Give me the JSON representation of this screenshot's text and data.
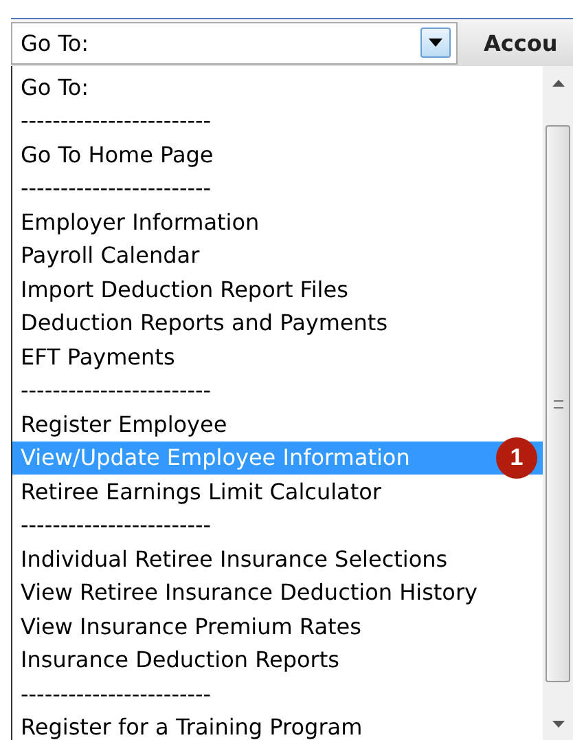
{
  "select": {
    "value": "Go To:"
  },
  "header": {
    "title": "Accou"
  },
  "options": [
    {
      "label": "Go To:",
      "selected": false
    },
    {
      "label": "------------------------",
      "selected": false
    },
    {
      "label": "Go To Home Page",
      "selected": false
    },
    {
      "label": "------------------------",
      "selected": false
    },
    {
      "label": "Employer Information",
      "selected": false
    },
    {
      "label": "Payroll Calendar",
      "selected": false
    },
    {
      "label": "Import Deduction Report Files",
      "selected": false
    },
    {
      "label": "Deduction Reports and Payments",
      "selected": false
    },
    {
      "label": "EFT Payments",
      "selected": false
    },
    {
      "label": "------------------------",
      "selected": false
    },
    {
      "label": "Register Employee",
      "selected": false
    },
    {
      "label": "View/Update Employee Information",
      "selected": true
    },
    {
      "label": "Retiree Earnings Limit Calculator",
      "selected": false
    },
    {
      "label": "------------------------",
      "selected": false
    },
    {
      "label": "Individual Retiree Insurance Selections",
      "selected": false
    },
    {
      "label": "View Retiree Insurance Deduction History",
      "selected": false
    },
    {
      "label": "View Insurance Premium Rates",
      "selected": false
    },
    {
      "label": "Insurance Deduction Reports",
      "selected": false
    },
    {
      "label": "------------------------",
      "selected": false
    },
    {
      "label": "Register for a Training Program",
      "selected": false
    }
  ],
  "callout": {
    "label": "1"
  }
}
